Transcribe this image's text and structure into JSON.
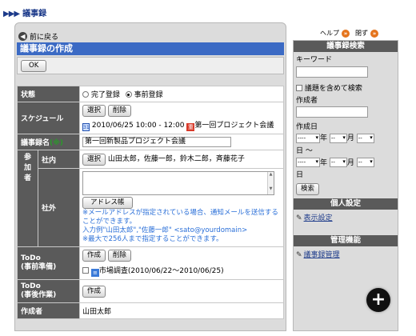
{
  "breadcrumb": {
    "arrows": "▶▶▶",
    "label": "議事録"
  },
  "main": {
    "back_label": "前に戻る",
    "title": "議事録の作成",
    "ok_label": "OK",
    "status": {
      "label": "状態",
      "options": [
        "完了登録",
        "事前登録"
      ],
      "selected": "事前登録"
    },
    "schedule": {
      "label": "スケジュール",
      "select_btn": "選択",
      "delete_btn": "削除",
      "datetime": "2010/06/25 10:00 - 12:00",
      "event_tag": "重",
      "event_name": "第一回プロジェクト会議"
    },
    "minutes_name": {
      "label": "議事録名",
      "required_mark": "(※)",
      "value": "第一回新製品プロジェクト会議"
    },
    "participants": {
      "label": "参加者",
      "internal_label": "社内",
      "internal_select_btn": "選択",
      "internal_names": "山田太郎，佐藤一郎，鈴木二郎，斉藤花子",
      "external_label": "社外",
      "address_book_btn": "アドレス帳",
      "note1": "※メールアドレスが指定されている場合、通知メールを送信することができます。",
      "note2": "入力例\"山田太郎\",\"佐藤一郎\" <sato@yourdomain>",
      "note3": "※最大で256人まで指定することができます。"
    },
    "todo_before": {
      "label_line1": "ToDo",
      "label_line2": "(事前準備)",
      "create_btn": "作成",
      "delete_btn": "削除",
      "task": "市場調査(2010/06/22〜2010/06/25)"
    },
    "todo_after": {
      "label_line1": "ToDo",
      "label_line2": "(事後作業)",
      "create_btn": "作成"
    },
    "author": {
      "label": "作成者",
      "value": "山田太郎"
    }
  },
  "sidebar": {
    "help_label": "ヘルプ",
    "close_label": "閉ず",
    "search_header": "議事録検索",
    "keyword_label": "キーワード",
    "include_topics_label": "議題を含めて検索",
    "author_label": "作成者",
    "date_label": "作成日",
    "date_from": {
      "year": "----",
      "year_unit": "年",
      "month": "--",
      "month_unit": "月",
      "day": "--",
      "day_unit": "日 〜"
    },
    "date_to": {
      "year": "----",
      "year_unit": "年",
      "month": "--",
      "month_unit": "月",
      "day": "--",
      "day_unit": "日"
    },
    "search_btn": "検索",
    "personal_header": "個人設定",
    "display_settings_link": "表示設定",
    "admin_header": "管理機能",
    "admin_link": "議事録管理"
  },
  "zoom_icon": "zoom-in-icon"
}
